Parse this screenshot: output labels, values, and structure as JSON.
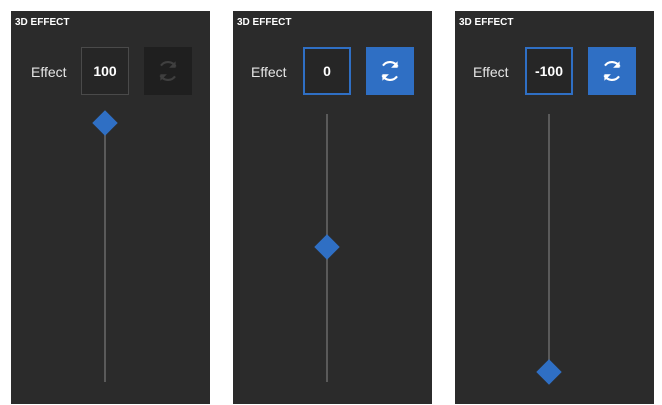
{
  "panels": [
    {
      "title": "3D EFFECT",
      "effect_label": "Effect",
      "value": "100",
      "reset_enabled": false,
      "slider_level": 1.0,
      "reset_icon": "refresh-icon"
    },
    {
      "title": "3D EFFECT",
      "effect_label": "Effect",
      "value": "0",
      "reset_enabled": true,
      "slider_level": 0.5,
      "reset_icon": "refresh-icon"
    },
    {
      "title": "3D EFFECT",
      "effect_label": "Effect",
      "value": "-100",
      "reset_enabled": true,
      "slider_level": 0.0,
      "reset_icon": "refresh-icon"
    }
  ],
  "colors": {
    "panel_bg": "#2b2b2b",
    "accent": "#2f6fc4",
    "track": "#5a5a5a",
    "disabled_button": "#1f1f1f"
  }
}
